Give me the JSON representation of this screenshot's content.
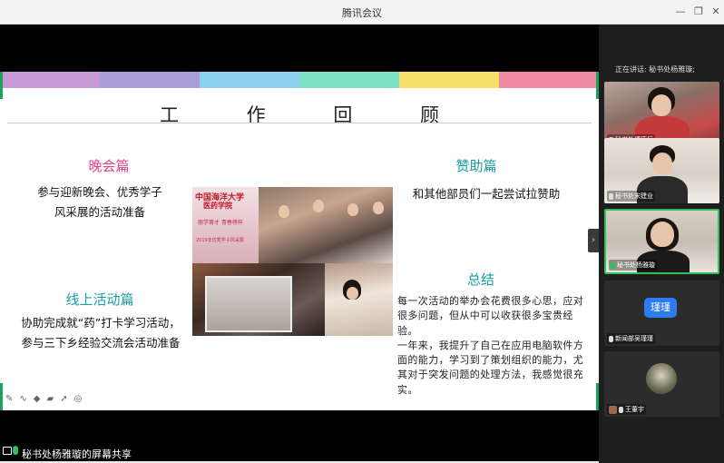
{
  "window": {
    "title": "腾讯会议"
  },
  "slide": {
    "title": "工 作 回 顾",
    "colorbar": [
      "#c99bd6",
      "#a99ed8",
      "#8ed0f0",
      "#7fe1c4",
      "#f6e06a",
      "#f08aa0"
    ],
    "accent_green": "#1aa35a",
    "sections": {
      "gala": {
        "heading": "晚会篇",
        "lines": [
          "参与迎新晚会、优秀学子",
          "风采展的活动准备"
        ]
      },
      "sponsor": {
        "heading": "赞助篇",
        "lines": [
          "和其他部员们一起尝试拉赞助"
        ]
      },
      "online": {
        "heading": "线上活动篇",
        "lines": [
          "协助完成就“药”打卡学习活动，",
          "参与三下乡经验交流会活动准备"
        ]
      },
      "summary": {
        "heading": "总结",
        "paragraph1": "每一次活动的举办会花费很多心思，应对很多问题，但从中可以收获很多宝贵经验。",
        "paragraph2": "一年来，我提升了自己在应用电脑软件方面的能力，学习到了策划组织的能力，尤其对于突发问题的处理方法，我感觉很充实。"
      }
    },
    "photo": {
      "poster_line1": "中国海洋大学",
      "poster_line2": "医药学院",
      "poster_line3": "丽学菁才 青春榜样",
      "poster_line4": "2019年优秀学子风采展"
    },
    "toolbar_icons": [
      "pen-icon",
      "curve-icon",
      "marker-icon",
      "eraser-icon",
      "pointer-icon",
      "laser-icon"
    ]
  },
  "share_bar": {
    "label": "秘书处杨雅璇的屏幕共享"
  },
  "participants_panel": {
    "speaking_label": "正在讲话: 秘书处杨雅璇;",
    "tiles": [
      {
        "name": "秘书处傅唐辰",
        "mic_on": false
      },
      {
        "name": "秘书处宋建业",
        "mic_on": false
      },
      {
        "name": "秘书处杨雅璇",
        "mic_on": true,
        "active": true
      },
      {
        "name": "新闻部吴瑾瑾",
        "mic_on": false,
        "avatar_text": "瑾瑾",
        "avatar_color": "#2e7bf0"
      },
      {
        "name": "王董宇",
        "mic_on": false
      }
    ]
  }
}
